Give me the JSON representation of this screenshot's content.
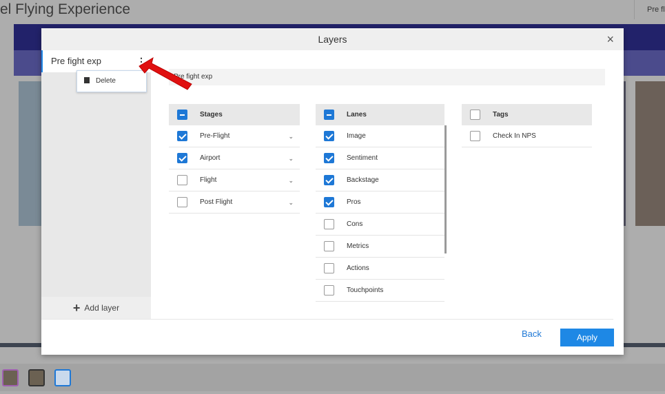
{
  "background": {
    "title": "el Flying Experience",
    "top_right": "Pre fli"
  },
  "modal": {
    "title": "Layers",
    "close": "×",
    "layers": [
      {
        "label": "Pre fight exp",
        "menu_icon": "⋮"
      }
    ],
    "context_menu": {
      "delete": "Delete"
    },
    "add_layer": "Add layer",
    "breadcrumb": "Pre fight exp",
    "stages": {
      "header": "Stages",
      "items": [
        {
          "label": "Pre-Flight",
          "checked": true
        },
        {
          "label": "Airport",
          "checked": true
        },
        {
          "label": "Flight",
          "checked": false
        },
        {
          "label": "Post Flight",
          "checked": false
        }
      ]
    },
    "lanes": {
      "header": "Lanes",
      "items": [
        {
          "label": "Image",
          "checked": true
        },
        {
          "label": "Sentiment",
          "checked": true
        },
        {
          "label": "Backstage",
          "checked": true
        },
        {
          "label": "Pros",
          "checked": true
        },
        {
          "label": "Cons",
          "checked": false
        },
        {
          "label": "Metrics",
          "checked": false
        },
        {
          "label": "Actions",
          "checked": false
        },
        {
          "label": "Touchpoints",
          "checked": false
        }
      ]
    },
    "tags": {
      "header": "Tags",
      "items": [
        {
          "label": "Check In NPS",
          "checked": false
        }
      ]
    },
    "back": "Back",
    "apply": "Apply"
  },
  "colors": {
    "accent": "#1e88e5",
    "arrow": "#e01010"
  }
}
